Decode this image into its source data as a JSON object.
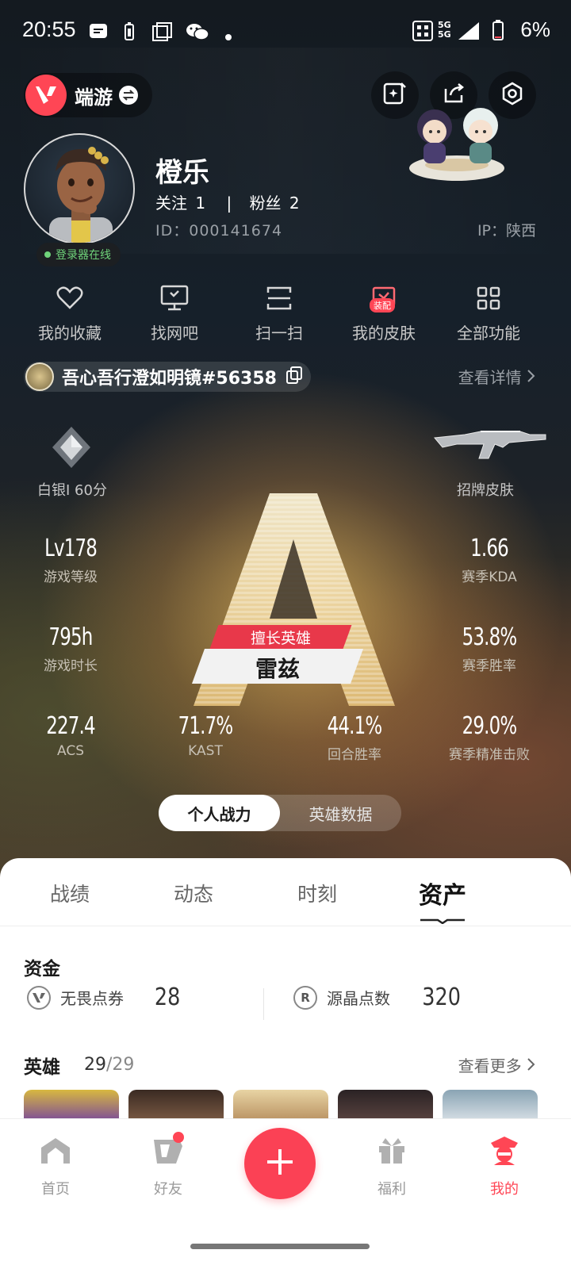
{
  "status_bar": {
    "time": "20:55",
    "network": "5G 5G",
    "battery": "6%"
  },
  "header": {
    "game_name": "端游",
    "icons": [
      "valorant-logo-icon",
      "swap-icon",
      "sparkle-edit-icon",
      "share-icon",
      "settings-hexagon-icon"
    ]
  },
  "profile": {
    "username": "橙乐",
    "follow_label": "关注",
    "follow_count": "1",
    "separator": "|",
    "fans_label": "粉丝",
    "fans_count": "2",
    "id": "ID：000141674",
    "ip": "IP：陕西",
    "online_status": "登录器在线"
  },
  "features": [
    {
      "label": "我的收藏",
      "icon": "heart-icon"
    },
    {
      "label": "找网吧",
      "icon": "monitor-icon"
    },
    {
      "label": "扫一扫",
      "icon": "scan-icon"
    },
    {
      "label": "我的皮肤",
      "icon": "skin-icon",
      "badge": "装配"
    },
    {
      "label": "全部功能",
      "icon": "grid-icon"
    }
  ],
  "riot_id": {
    "name": "吾心吾行澄如明镜#56358",
    "view_details": "查看详情"
  },
  "stats": {
    "rank_label": "白银I 60分",
    "signature_skin_label": "招牌皮肤",
    "level_value": "Lv178",
    "level_label": "游戏等级",
    "kda_value": "1.66",
    "kda_label": "赛季KDA",
    "hours_value": "795h",
    "hours_label": "游戏时长",
    "winrate_value": "53.8%",
    "winrate_label": "赛季胜率",
    "acs_value": "227.4",
    "acs_label": "ACS",
    "kast_value": "71.7%",
    "kast_label": "KAST",
    "round_win_value": "44.1%",
    "round_win_label": "回合胜率",
    "precision_value": "29.0%",
    "precision_label": "赛季精准击败",
    "best_hero_tag": "擅长英雄",
    "best_hero_name": "雷兹",
    "rank_letter": "A"
  },
  "toggle": {
    "active": "个人战力",
    "inactive": "英雄数据"
  },
  "tabs": [
    "战绩",
    "动态",
    "时刻",
    "资产"
  ],
  "assets": {
    "funds_title": "资金",
    "vp_label": "无畏点券",
    "vp_value": "28",
    "rp_label": "源晶点数",
    "rp_value": "320",
    "heroes_title": "英雄",
    "heroes_owned": "29",
    "heroes_total": "/29",
    "see_more": "查看更多"
  },
  "bottom_nav": [
    {
      "label": "首页",
      "icon": "home-icon"
    },
    {
      "label": "好友",
      "icon": "friends-icon"
    },
    {
      "label": "",
      "icon": "plus-icon"
    },
    {
      "label": "福利",
      "icon": "gift-icon"
    },
    {
      "label": "我的",
      "icon": "profile-icon"
    }
  ],
  "colors": {
    "accent": "#ff4655",
    "online": "#6fd37a",
    "banner_red": "#e8384a"
  }
}
